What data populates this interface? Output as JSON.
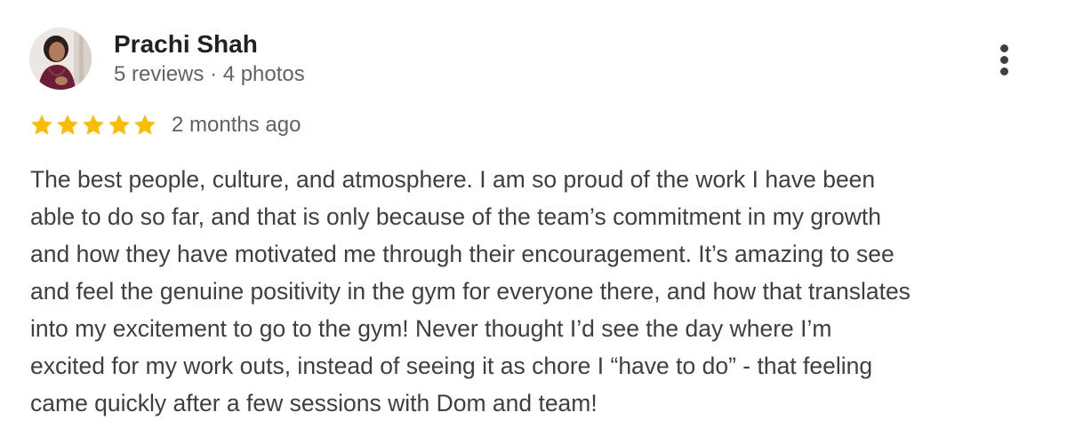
{
  "reviewer": {
    "name": "Prachi Shah",
    "meta": "5 reviews · 4 photos",
    "avatar_icon": "user-photo"
  },
  "review": {
    "rating": 5,
    "rating_max": 5,
    "star_color": "#FBBC04",
    "date": "2 months ago",
    "text_lines": [
      "The best people, culture, and atmosphere. I am so proud of the work I have been",
      "able to do so far, and that is only because of the team’s commitment in my growth",
      "and how they have motivated me through their encouragement. It’s amazing to see",
      "and feel the genuine positivity in the gym for everyone there, and how that translates",
      "into my excitement to go to the gym! Never thought I’d see the day where I’m",
      "excited for my work outs, instead of seeing it as chore I “have to do” - that feeling",
      "came quickly after a few sessions with Dom and team!"
    ]
  },
  "actions": {
    "more_icon": "more-vert-icon"
  }
}
